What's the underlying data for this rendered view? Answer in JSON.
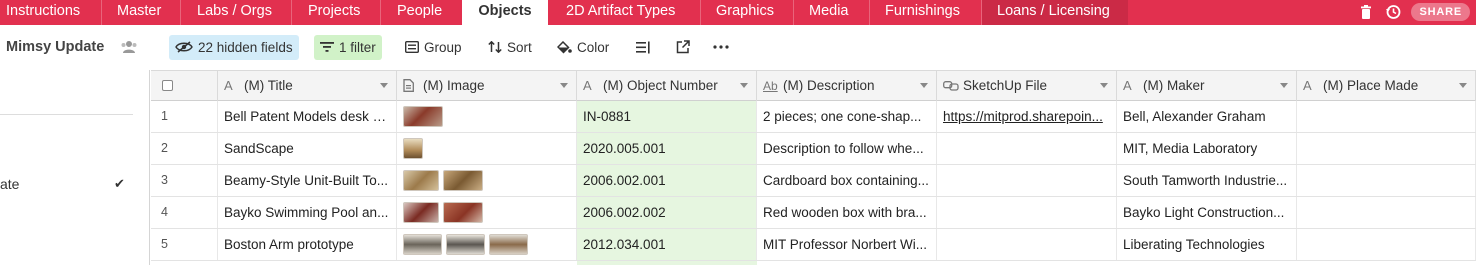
{
  "tabs": [
    {
      "label": "Instructions"
    },
    {
      "label": "Master"
    },
    {
      "label": "Labs / Orgs"
    },
    {
      "label": "Projects"
    },
    {
      "label": "People"
    },
    {
      "label": "Objects"
    },
    {
      "label": "2D Artifact Types"
    },
    {
      "label": "Graphics"
    },
    {
      "label": "Media"
    },
    {
      "label": "Furnishings"
    },
    {
      "label": "Loans / Licensing"
    }
  ],
  "active_tab": "Objects",
  "share_label": "SHARE",
  "toolbar": {
    "view_name": "Mimsy Update",
    "hidden_fields": "22 hidden fields",
    "filter": "1 filter",
    "group": "Group",
    "sort": "Sort",
    "color": "Color"
  },
  "sidebar": {
    "item_label": "ate"
  },
  "columns": [
    {
      "label": "(M) Title",
      "icon": "text-field-icon"
    },
    {
      "label": "(M) Image",
      "icon": "attachment-icon"
    },
    {
      "label": "(M) Object Number",
      "icon": "text-field-icon"
    },
    {
      "label": "(M) Description",
      "icon": "long-text-icon"
    },
    {
      "label": "SketchUp File",
      "icon": "link-field-icon"
    },
    {
      "label": "(M) Maker",
      "icon": "text-field-icon"
    },
    {
      "label": "(M) Place Made",
      "icon": "text-field-icon"
    }
  ],
  "rows": [
    {
      "num": "1",
      "title": "Bell Patent Models desk s...",
      "thumbs": 1,
      "object_number": "IN-0881",
      "description": "2 pieces; one cone-shap...",
      "sketchup": "https://mitprod.sharepoin...",
      "maker": "Bell, Alexander Graham",
      "place": ""
    },
    {
      "num": "2",
      "title": "SandScape",
      "thumbs": 1,
      "object_number": "2020.005.001",
      "description": "Description to follow whe...",
      "sketchup": "",
      "maker": "MIT, Media Laboratory",
      "place": ""
    },
    {
      "num": "3",
      "title": "Beamy-Style Unit-Built To...",
      "thumbs": 2,
      "object_number": "2006.002.001",
      "description": "Cardboard box containing...",
      "sketchup": "",
      "maker": "South Tamworth Industrie...",
      "place": ""
    },
    {
      "num": "4",
      "title": "Bayko Swimming Pool an...",
      "thumbs": 2,
      "object_number": "2006.002.002",
      "description": "Red wooden box with bra...",
      "sketchup": "",
      "maker": "Bayko Light Construction...",
      "place": ""
    },
    {
      "num": "5",
      "title": "Boston Arm prototype",
      "thumbs": 3,
      "object_number": "2012.034.001",
      "description": "MIT Professor Norbert Wi...",
      "sketchup": "",
      "maker": "Liberating Technologies",
      "place": ""
    }
  ],
  "colors": {
    "topbar": "#e2304f",
    "hidden_fields_bg": "#d3ecf9",
    "filter_bg": "#d1f2c8",
    "object_number_bg": "#e6f6e0"
  }
}
